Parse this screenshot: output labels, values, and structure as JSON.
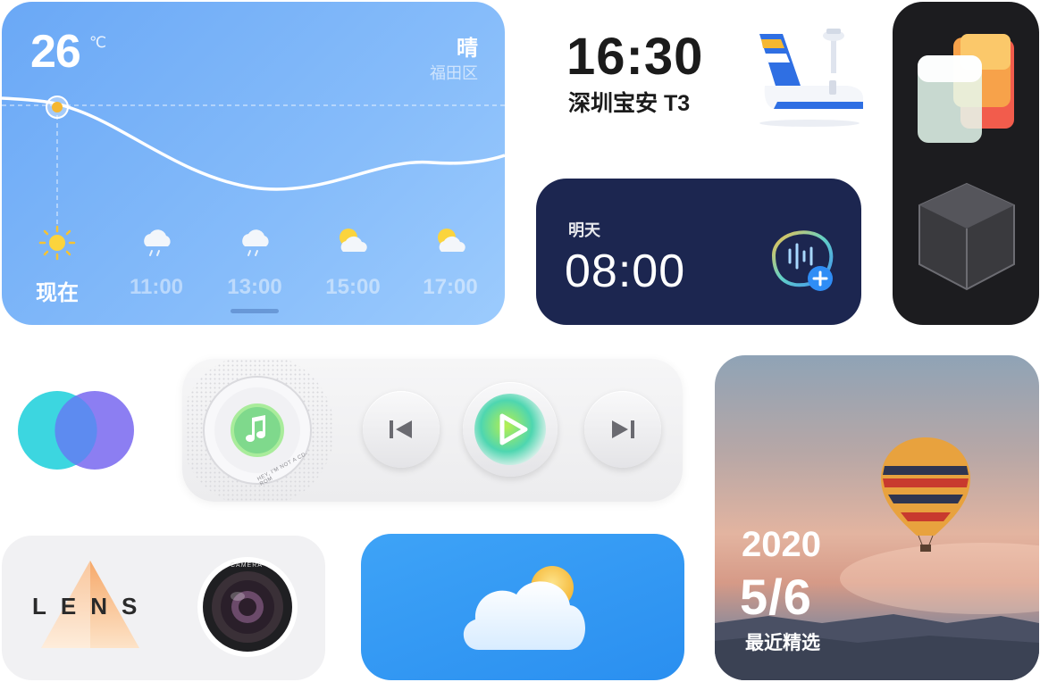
{
  "weather": {
    "temperature": "26",
    "unit": "℃",
    "condition": "晴",
    "location": "福田区",
    "forecast": [
      {
        "label": "现在",
        "icon": "sun-icon"
      },
      {
        "label": "11:00",
        "icon": "rain-cloud-icon"
      },
      {
        "label": "13:00",
        "icon": "rain-cloud-icon"
      },
      {
        "label": "15:00",
        "icon": "partly-cloudy-icon"
      },
      {
        "label": "17:00",
        "icon": "partly-cloudy-icon"
      }
    ]
  },
  "flight": {
    "time": "16:30",
    "place": "深圳宝安  T3",
    "icon": "airplane-tower-icon"
  },
  "alarm": {
    "day": "明天",
    "time": "08:00",
    "add_icon": "plus-icon"
  },
  "music": {
    "disc_text": "HEY, I'M NOT A CD-ROM",
    "prev_icon": "skip-previous-icon",
    "play_icon": "play-icon",
    "next_icon": "skip-next-icon"
  },
  "lens": {
    "word": "LENS",
    "camera_text": "CAMERA"
  },
  "photo": {
    "year": "2020",
    "date": "5/6",
    "caption": "最近精选"
  },
  "colors": {
    "weather_bg": "#7db4f8",
    "alarm_bg": "#1c2650",
    "cloud_bg": "#2f95f3",
    "dark_bg": "#1c1c1f"
  }
}
